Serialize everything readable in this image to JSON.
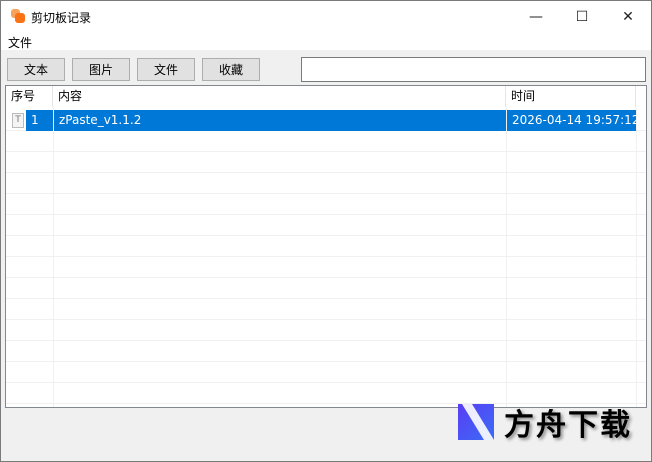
{
  "window": {
    "title": "剪切板记录",
    "minimize": "—",
    "maximize": "☐",
    "close": "✕"
  },
  "menu": {
    "file": "文件"
  },
  "toolbar": {
    "buttons": [
      "文本",
      "图片",
      "文件",
      "收藏"
    ],
    "search_value": ""
  },
  "table": {
    "headers": [
      "序号",
      "内容",
      "时间"
    ],
    "rows": [
      {
        "index": "1",
        "content": "zPaste_v1.1.2",
        "time": "2026-04-14 19:57:12",
        "selected": true
      }
    ]
  },
  "watermark": {
    "text": "方舟下载"
  },
  "colors": {
    "selection": "#0078d7",
    "accent": "#f97316"
  }
}
